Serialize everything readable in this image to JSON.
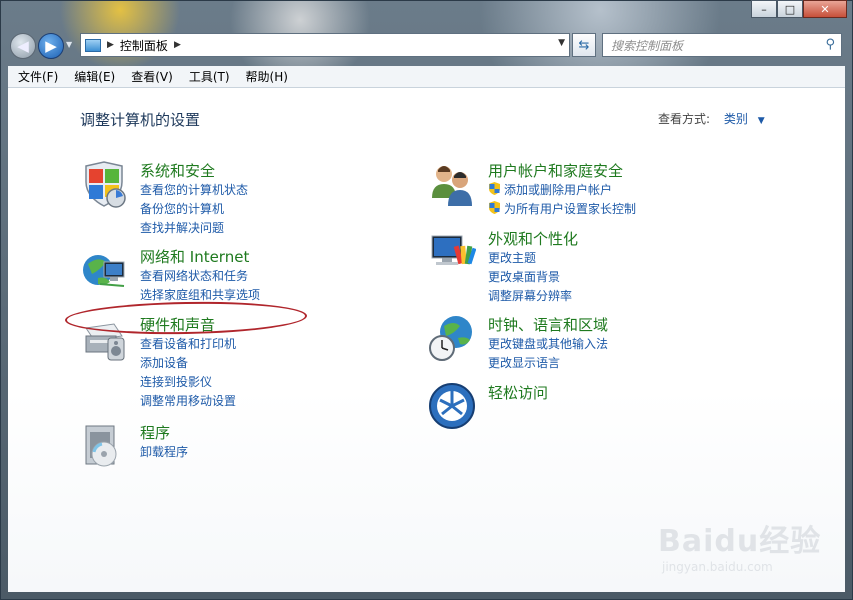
{
  "window": {
    "caption_buttons": [
      "–",
      "□",
      "✕"
    ]
  },
  "nav": {
    "breadcrumb": "控制面板",
    "search_placeholder": "搜索控制面板"
  },
  "menu": [
    "文件(F)",
    "编辑(E)",
    "查看(V)",
    "工具(T)",
    "帮助(H)"
  ],
  "main": {
    "title": "调整计算机的设置",
    "view_by_label": "查看方式:",
    "view_by_value": "类别"
  },
  "categories": [
    {
      "key": "system",
      "icon": "system-security-icon",
      "title": "系统和安全",
      "links": [
        "查看您的计算机状态",
        "备份您的计算机",
        "查找并解决问题"
      ]
    },
    {
      "key": "network",
      "icon": "network-internet-icon",
      "title": "网络和 Internet",
      "links": [
        "查看网络状态和任务",
        "选择家庭组和共享选项"
      ]
    },
    {
      "key": "hardware",
      "icon": "hardware-sound-icon",
      "title": "硬件和声音",
      "links": [
        "查看设备和打印机",
        "添加设备",
        "连接到投影仪",
        "调整常用移动设置"
      ]
    },
    {
      "key": "programs",
      "icon": "programs-icon",
      "title": "程序",
      "links": [
        "卸载程序"
      ]
    },
    {
      "key": "user",
      "icon": "user-accounts-icon",
      "title": "用户帐户和家庭安全",
      "links": [
        "添加或删除用户帐户",
        "为所有用户设置家长控制"
      ]
    },
    {
      "key": "appearance",
      "icon": "appearance-icon",
      "title": "外观和个性化",
      "links": [
        "更改主题",
        "更改桌面背景",
        "调整屏幕分辨率"
      ]
    },
    {
      "key": "clock",
      "icon": "clock-region-icon",
      "title": "时钟、语言和区域",
      "links": [
        "更改键盘或其他输入法",
        "更改显示语言"
      ]
    },
    {
      "key": "ease",
      "icon": "ease-of-access-icon",
      "title": "轻松访问",
      "links": []
    }
  ],
  "watermark": {
    "logo": "Baidu经验",
    "url": "jingyan.baidu.com"
  },
  "colors": {
    "link": "#1e5aa8",
    "category_title": "#1f7a1f",
    "annotation": "#b0262c"
  }
}
